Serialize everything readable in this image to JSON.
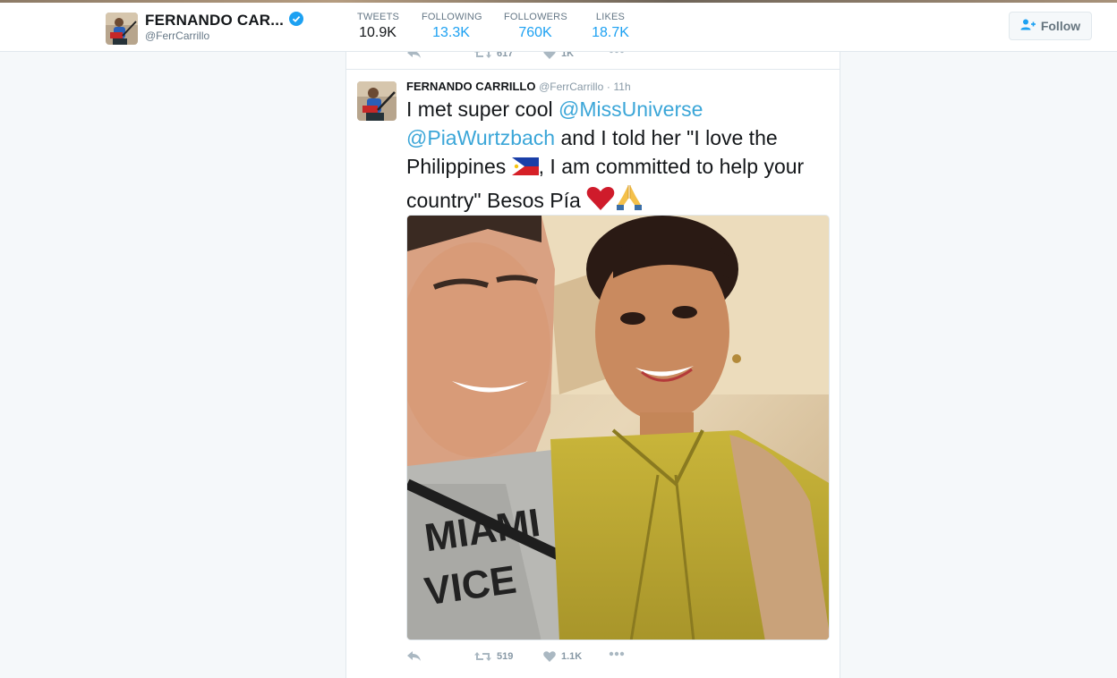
{
  "profile": {
    "name": "FERNANDO CAR...",
    "handle": "@FerrCarrillo"
  },
  "stats": [
    {
      "label": "TWEETS",
      "value": "10.9K"
    },
    {
      "label": "FOLLOWING",
      "value": "13.3K"
    },
    {
      "label": "FOLLOWERS",
      "value": "760K"
    },
    {
      "label": "LIKES",
      "value": "18.7K"
    }
  ],
  "follow_button": {
    "label": "Follow"
  },
  "previous_tweet": {
    "retweets": "617",
    "likes": "1K"
  },
  "tweet": {
    "fullname": "FERNANDO CARRILLO",
    "handle": "@FerrCarrillo",
    "separator": "·",
    "time": "11h",
    "text": {
      "part1": "I met super cool ",
      "mention1": "@MissUniverse",
      "mention2": "@PiaWurtzbach",
      "part2": " and I told her \"I love the Philippines ",
      "part3": ", I am committed to help your country\" Besos Pía "
    },
    "retweets": "519",
    "likes": "1.1K"
  },
  "icons": {
    "verified": "verified-badge-icon",
    "follow": "add-user-icon",
    "reply": "reply-icon",
    "retweet": "retweet-icon",
    "like": "heart-icon",
    "more": "more-dots-icon",
    "flag": "philippines-flag-emoji",
    "heart_emoji": "red-heart-emoji",
    "pray": "folded-hands-emoji"
  },
  "colors": {
    "accent": "#1da1f2",
    "mention": "#3ba6d8",
    "muted": "#8899a6"
  }
}
